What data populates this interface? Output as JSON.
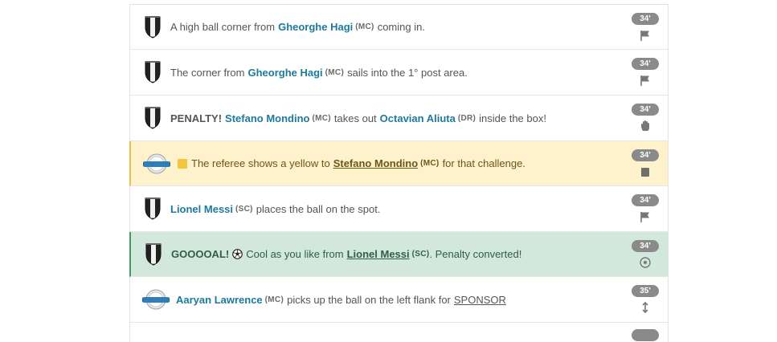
{
  "events": [
    {
      "minute": "34'",
      "icon": "flag-icon",
      "parts": {
        "pre": "A high ball corner from",
        "player": "Gheorghe Hagi",
        "pos": "(MC)",
        "post": "coming in."
      }
    },
    {
      "minute": "34'",
      "icon": "flag-icon",
      "parts": {
        "pre": "The corner from",
        "player": "Gheorghe Hagi",
        "pos": "(MC)",
        "post": "sails into the 1° post area."
      }
    },
    {
      "minute": "34'",
      "icon": "hand-icon",
      "parts": {
        "lead": "PENALTY!",
        "player1": "Stefano Mondino",
        "pos1": "(MC)",
        "mid": "takes out",
        "player2": "Octavian Aliuta",
        "pos2": "(DR)",
        "post": "inside the box!"
      }
    },
    {
      "minute": "34'",
      "icon": "card-icon",
      "parts": {
        "pre": "The referee shows a yellow to",
        "player": "Stefano Mondino",
        "pos": "(MC)",
        "post": "for that challenge."
      }
    },
    {
      "minute": "34'",
      "icon": "flag-icon",
      "parts": {
        "player": "Lionel Messi",
        "pos": "(SC)",
        "post": "places the ball on the spot."
      }
    },
    {
      "minute": "34'",
      "icon": "ball-icon",
      "parts": {
        "lead": "GOOOOAL!",
        "pre": "Cool as you like from",
        "player": "Lionel Messi",
        "pos": "(SC)",
        "post": ". Penalty converted!"
      }
    },
    {
      "minute": "35'",
      "icon": "arrows-vertical-icon",
      "parts": {
        "player": "Aaryan Lawrence",
        "pos": "(MC)",
        "post": "picks up the ball on the left flank for",
        "link": "SPONSOR"
      }
    }
  ],
  "colors": {
    "player_link": "#1c7a9c",
    "yellow_row": "#fdf2cc",
    "goal_row": "#d3e8dd",
    "minute_badge": "#8a8a8a"
  }
}
